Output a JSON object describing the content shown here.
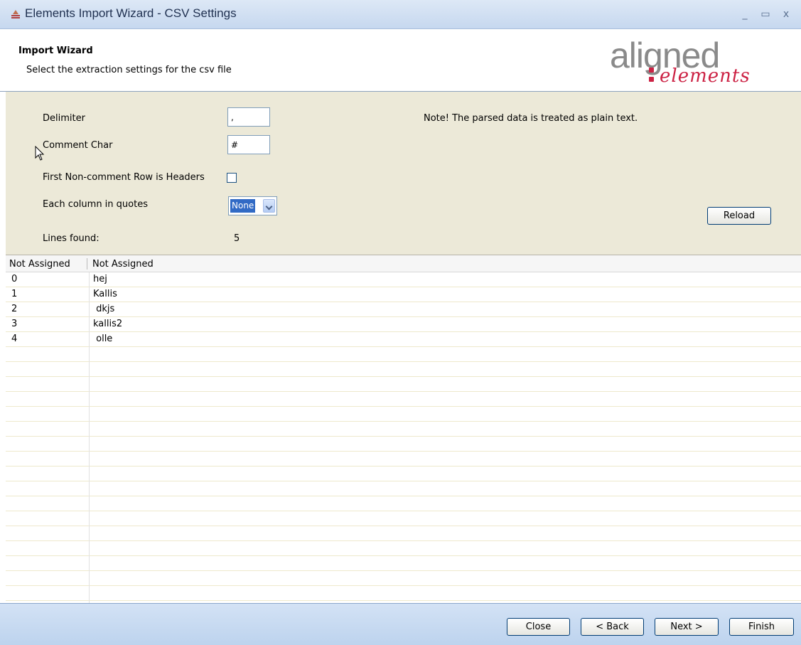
{
  "window": {
    "title": "Elements Import Wizard - CSV Settings",
    "minimize": "_",
    "maximize": "▭",
    "close": "x"
  },
  "header": {
    "title": "Import Wizard",
    "subtitle": "Select the extraction settings for the csv file",
    "logo_main": "aligned",
    "logo_sub": "elements"
  },
  "settings": {
    "delimiter_label": "Delimiter",
    "delimiter_value": ",",
    "comment_label": "Comment Char",
    "comment_value": "#",
    "headers_label": "First Non-comment Row is Headers",
    "headers_checked": false,
    "quotes_label": "Each column in quotes",
    "quotes_value": "None",
    "lines_label": "Lines found:",
    "lines_value": "5",
    "note": "Note! The parsed data is treated as plain text.",
    "reload_label": "Reload"
  },
  "table": {
    "columns": [
      "Not Assigned",
      "Not Assigned"
    ],
    "rows": [
      [
        "0",
        "hej"
      ],
      [
        "1",
        "Kallis"
      ],
      [
        "2",
        " dkjs"
      ],
      [
        "3",
        "kallis2"
      ],
      [
        "4",
        " olle"
      ]
    ]
  },
  "footer": {
    "close_label": "Close",
    "back_label": "< Back",
    "next_label": "Next >",
    "finish_label": "Finish"
  }
}
